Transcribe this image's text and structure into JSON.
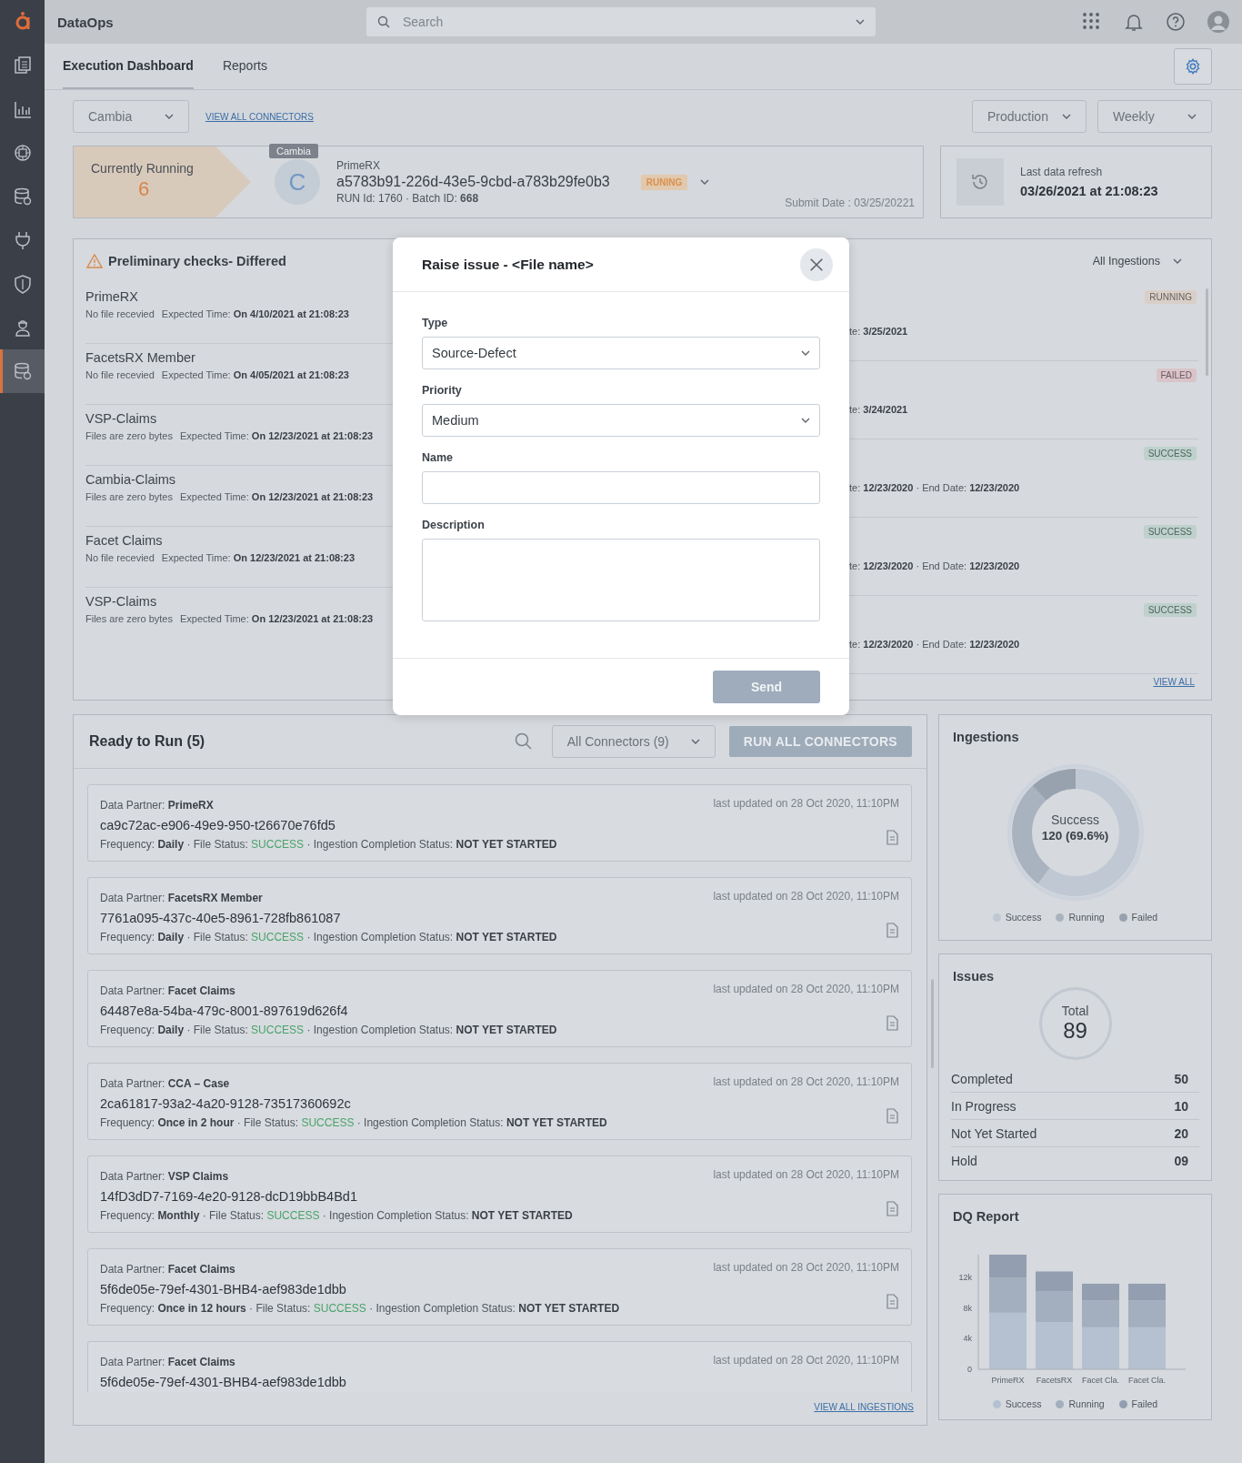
{
  "app": {
    "title": "DataOps"
  },
  "sidebar": {
    "items": [
      {
        "selected": false
      },
      {
        "selected": false
      },
      {
        "selected": false
      },
      {
        "selected": false
      },
      {
        "selected": false
      },
      {
        "selected": false
      },
      {
        "selected": false
      },
      {
        "selected": true
      }
    ]
  },
  "search": {
    "placeholder": "Search"
  },
  "tabs": [
    {
      "label": "Execution Dashboard",
      "selected": true
    },
    {
      "label": "Reports",
      "selected": false
    }
  ],
  "filters": {
    "connector": "Cambia",
    "link": "VIEW ALL CONNECTORS",
    "environment": "Production",
    "period": "Weekly"
  },
  "running": {
    "label": "Currently Running",
    "count": "6",
    "tooltip": "Cambia",
    "avatar": "C",
    "partner": "PrimeRX",
    "id": "a5783b91-226d-43e5-9cbd-a783b29fe0b3",
    "status": "RUNING",
    "run_info": "RUN Id: 1760 · Batch ID: **668**",
    "submit_date": "Submit Date : 03/25/20221"
  },
  "refresh": {
    "label": "Last data refresh",
    "value": "03/26/2021 at 21:08:23"
  },
  "checks": {
    "title": "Preliminary checks- Differed",
    "items": [
      {
        "name": "PrimeRX",
        "reason": "No file recevied",
        "expected": "Expected Time: **On 4/10/2021 at 21:08:23**"
      },
      {
        "name": "FacetsRX Member",
        "reason": "No file recevied",
        "expected": "Expected Time: **On 4/05/2021 at 21:08:23**"
      },
      {
        "name": "VSP-Claims",
        "reason": "Files are zero bytes",
        "expected": "Expected Time: **On 12/23/2021 at 21:08:23**"
      },
      {
        "name": "Cambia-Claims",
        "reason": "Files are zero bytes",
        "expected": "Expected Time: **On 12/23/2021 at 21:08:23**"
      },
      {
        "name": "Facet Claims",
        "reason": "No file recevied",
        "expected": "Expected Time: **On 12/23/2021 at 21:08:23**"
      },
      {
        "name": "VSP-Claims",
        "reason": "Files are zero bytes",
        "expected": "Expected Time: **On 12/23/2021 at 21:08:23**"
      }
    ]
  },
  "ingestions": {
    "filter": "All Ingestions",
    "link": "VIEW ALL",
    "items": [
      {
        "status": "RUNNING",
        "kind": "running",
        "dates": "te: **3/25/2021**"
      },
      {
        "status": "FAILED",
        "kind": "failed",
        "dates": "te: **3/24/2021**"
      },
      {
        "status": "SUCCESS",
        "kind": "success",
        "dates": "te: **12/23/2020** · End Date: **12/23/2020**"
      },
      {
        "status": "SUCCESS",
        "kind": "success",
        "dates": "te: **12/23/2020** · End Date: **12/23/2020**"
      },
      {
        "status": "SUCCESS",
        "kind": "success",
        "dates": "te: **12/23/2020** · End Date: **12/23/2020**"
      }
    ]
  },
  "ready": {
    "title": "Ready to Run (5)",
    "filter": "All Connectors (9)",
    "button": "RUN ALL CONNECTORS",
    "link": "VIEW ALL INGESTIONS",
    "cards": [
      {
        "partner": "Data Partner: **PrimeRX**",
        "updated": "last updated on 28 Oct 2020, 11:10PM",
        "id": "ca9c72ac-e906-49e9-950-t26670e76fd5",
        "meta_before": "Frequency: **Daily** · File Status:",
        "file_status": "SUCCESS",
        "meta_after": "· Ingestion Completion Status: **NOT YET STARTED**"
      },
      {
        "partner": "Data Partner: **FacetsRX Member**",
        "updated": "last updated on 28 Oct 2020, 11:10PM",
        "id": "7761a095-437c-40e5-8961-728fb861087",
        "meta_before": "Frequency: **Daily** · File Status:",
        "file_status": "SUCCESS",
        "meta_after": "· Ingestion Completion Status: **NOT YET STARTED**"
      },
      {
        "partner": "Data Partner: **Facet Claims**",
        "updated": "last updated on 28 Oct 2020, 11:10PM",
        "id": "64487e8a-54ba-479c-8001-897619d626f4",
        "meta_before": "Frequency: **Daily** · File Status:",
        "file_status": "SUCCESS",
        "meta_after": "· Ingestion Completion Status: **NOT YET STARTED**"
      },
      {
        "partner": "Data Partner:  **CCA – Case**",
        "updated": "last updated on 28 Oct 2020, 11:10PM",
        "id": "2ca61817-93a2-4a20-9128-73517360692c",
        "meta_before": "Frequency: **Once in 2 hour** · File Status:",
        "file_status": "SUCCESS",
        "meta_after": "· Ingestion Completion Status: **NOT YET STARTED**"
      },
      {
        "partner": "Data Partner: **VSP Claims**",
        "updated": "last updated on 28 Oct 2020, 11:10PM",
        "id": "14fD3dD7-7169-4e20-9128-dcD19bbB4Bd1",
        "meta_before": "Frequency: **Monthly** · File Status:",
        "file_status": "SUCCESS",
        "meta_after": "· Ingestion Completion Status: **NOT YET STARTED**"
      },
      {
        "partner": "Data Partner: **Facet Claims**",
        "updated": "last updated on 28 Oct 2020, 11:10PM",
        "id": "5f6de05e-79ef-4301-BHB4-aef983de1dbb",
        "meta_before": "Frequency: **Once in 12 hours** · File Status:",
        "file_status": "SUCCESS",
        "meta_after": "· Ingestion Completion Status: **NOT YET STARTED**"
      },
      {
        "partner": "Data Partner: **Facet Claims**",
        "updated": "last updated on 28 Oct 2020, 11:10PM",
        "id": "5f6de05e-79ef-4301-BHB4-aef983de1dbb"
      }
    ]
  },
  "ingestion_summary": {
    "title": "Ingestions",
    "center_label": "Success",
    "center_value": "120 (69.6%)",
    "legend": [
      {
        "label": "Success",
        "color": "#c0c8d3"
      },
      {
        "label": "Running",
        "color": "#a9b3bf"
      },
      {
        "label": "Failed",
        "color": "#98a2af"
      }
    ]
  },
  "issues": {
    "title": "Issues",
    "total_label": "Total",
    "total": "89",
    "rows": [
      {
        "label": "Completed",
        "value": "50"
      },
      {
        "label": "In Progress",
        "value": "10"
      },
      {
        "label": "Not Yet Started",
        "value": "20"
      },
      {
        "label": "Hold",
        "value": "09"
      }
    ]
  },
  "dq_report": {
    "title": "DQ Report",
    "chart_data": {
      "type": "bar",
      "stacked": true,
      "categories": [
        "PrimeRX",
        "FacetsRX",
        "Facet Cla.",
        "Facet Cla."
      ],
      "ylim": [
        0,
        15000
      ],
      "yticks": [
        {
          "value": 0,
          "label": "0"
        },
        {
          "value": 4000,
          "label": "4k"
        },
        {
          "value": 8000,
          "label": "8k"
        },
        {
          "value": 12000,
          "label": "12k"
        }
      ],
      "series": [
        {
          "name": "Success",
          "color": "#b5c1d1",
          "values": [
            7400,
            6200,
            5500,
            5500
          ]
        },
        {
          "name": "Running",
          "color": "#a3aebe",
          "values": [
            4600,
            4000,
            3500,
            3500
          ]
        },
        {
          "name": "Failed",
          "color": "#939fb0",
          "values": [
            3000,
            2600,
            2200,
            2200
          ]
        }
      ]
    }
  },
  "modal": {
    "title": "Raise issue - <File name>",
    "fields": [
      {
        "kind": "select",
        "label": "Type",
        "value": "Source-Defect"
      },
      {
        "kind": "select",
        "label": "Priority",
        "value": "Medium"
      },
      {
        "kind": "input",
        "label": "Name"
      },
      {
        "kind": "textarea",
        "label": "Description"
      }
    ],
    "send": {
      "label": "Send",
      "disabled": true
    }
  }
}
